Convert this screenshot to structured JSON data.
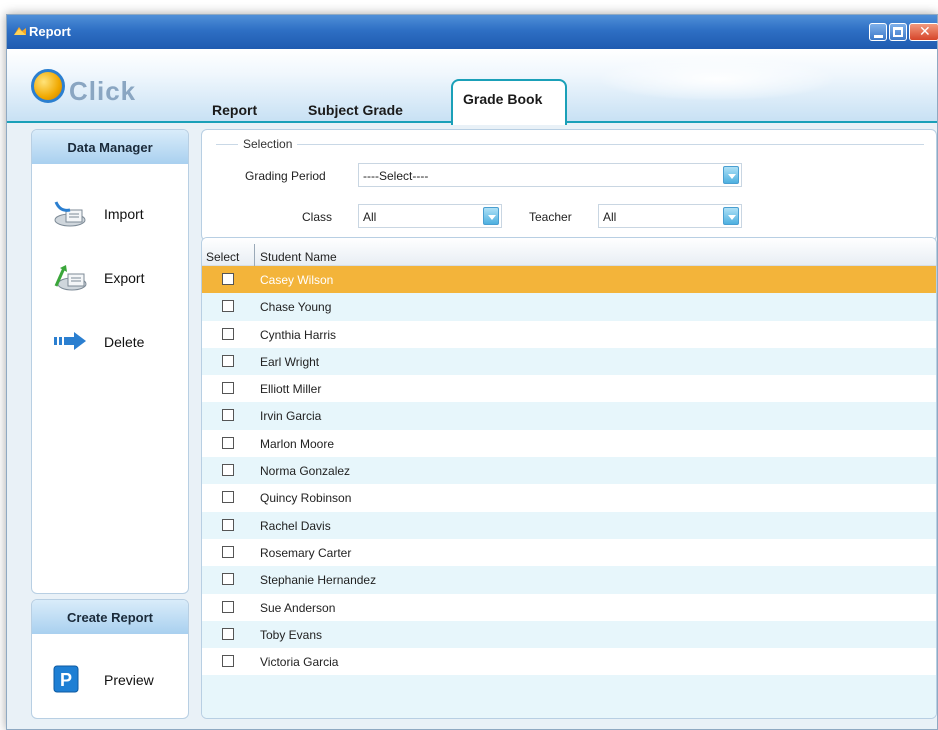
{
  "window": {
    "title": "Report"
  },
  "logo": {
    "text": "Click"
  },
  "tabs": [
    {
      "label": "Report"
    },
    {
      "label": "Subject Grade"
    },
    {
      "label": "Grade Book",
      "active": true
    }
  ],
  "sidebar": {
    "data_manager": {
      "title": "Data Manager",
      "items": [
        {
          "label": "Import",
          "icon": "import-icon"
        },
        {
          "label": "Export",
          "icon": "export-icon"
        },
        {
          "label": "Delete",
          "icon": "delete-arrow-icon"
        }
      ]
    },
    "create_report": {
      "title": "Create Report",
      "items": [
        {
          "label": "Preview",
          "icon": "preview-p-icon"
        }
      ]
    }
  },
  "selection": {
    "legend": "Selection",
    "grading_period": {
      "label": "Grading Period",
      "value": "----Select----"
    },
    "class": {
      "label": "Class",
      "value": "All"
    },
    "teacher": {
      "label": "Teacher",
      "value": "All"
    }
  },
  "grid": {
    "columns": [
      "Select",
      "Student Name"
    ],
    "selected_row": 0,
    "rows": [
      "Casey Wilson",
      "Chase Young",
      "Cynthia Harris",
      "Earl Wright",
      "Elliott Miller",
      "Irvin Garcia",
      "Marlon Moore",
      "Norma Gonzalez",
      "Quincy Robinson",
      "Rachel Davis",
      "Rosemary Carter",
      "Stephanie Hernandez",
      "Sue Anderson",
      "Toby Evans",
      "Victoria Garcia"
    ]
  },
  "colors": {
    "titlebar": "#2e6fc4",
    "accent": "#1aa0b8",
    "selected_row": "#f3b43a",
    "alt_row": "#e7f6fb"
  }
}
